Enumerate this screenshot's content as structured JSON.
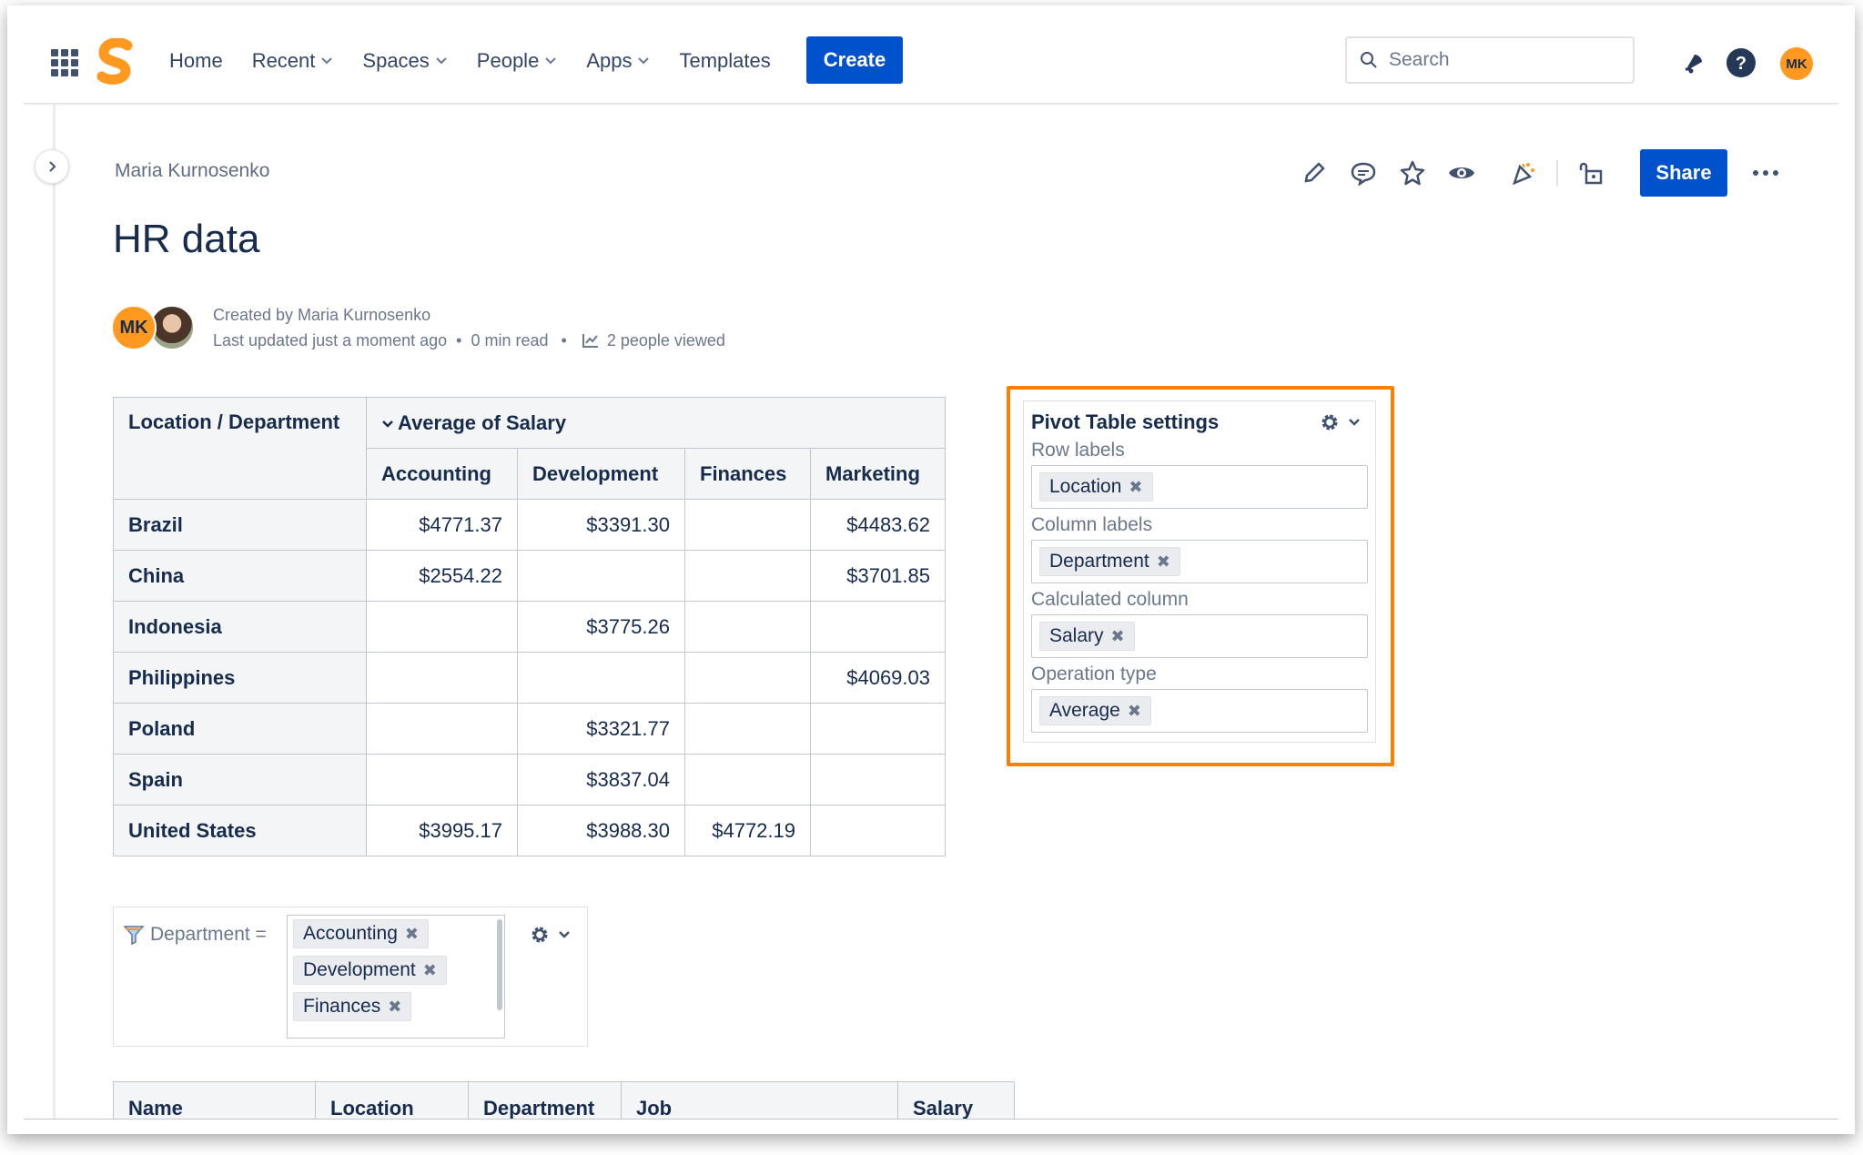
{
  "nav": {
    "items": [
      {
        "label": "Home",
        "dropdown": false
      },
      {
        "label": "Recent",
        "dropdown": true
      },
      {
        "label": "Spaces",
        "dropdown": true
      },
      {
        "label": "People",
        "dropdown": true
      },
      {
        "label": "Apps",
        "dropdown": true
      },
      {
        "label": "Templates",
        "dropdown": false
      }
    ],
    "create_label": "Create",
    "search_placeholder": "Search",
    "user_initials": "MK"
  },
  "page": {
    "breadcrumb": "Maria Kurnosenko",
    "title": "HR data",
    "share_label": "Share",
    "author_initials": "MK",
    "created_by": "Created by Maria Kurnosenko",
    "last_updated": "Last updated just a moment ago",
    "read_time": "0 min read",
    "viewed": "2 people viewed"
  },
  "pivot": {
    "corner_label": "Location / Department",
    "measure_label": "Average of Salary",
    "columns": [
      "Accounting",
      "Development",
      "Finances",
      "Marketing"
    ],
    "rows": [
      {
        "label": "Brazil",
        "values": [
          "$4771.37",
          "$3391.30",
          "",
          "$4483.62"
        ]
      },
      {
        "label": "China",
        "values": [
          "$2554.22",
          "",
          "",
          "$3701.85"
        ]
      },
      {
        "label": "Indonesia",
        "values": [
          "",
          "$3775.26",
          "",
          ""
        ]
      },
      {
        "label": "Philippines",
        "values": [
          "",
          "",
          "",
          "$4069.03"
        ]
      },
      {
        "label": "Poland",
        "values": [
          "",
          "$3321.77",
          "",
          ""
        ]
      },
      {
        "label": "Spain",
        "values": [
          "",
          "$3837.04",
          "",
          ""
        ]
      },
      {
        "label": "United States",
        "values": [
          "$3995.17",
          "$3988.30",
          "$4772.19",
          ""
        ]
      }
    ]
  },
  "settings": {
    "title": "Pivot Table settings",
    "row_labels_label": "Row labels",
    "row_labels_value": "Location",
    "column_labels_label": "Column labels",
    "column_labels_value": "Department",
    "calculated_label": "Calculated column",
    "calculated_value": "Salary",
    "operation_label": "Operation type",
    "operation_value": "Average",
    "highlight_color": "#ff7f00"
  },
  "filter": {
    "label": "Department =",
    "values": [
      "Accounting",
      "Development",
      "Finances"
    ]
  },
  "data_table": {
    "headers": [
      "Name",
      "Location",
      "Department",
      "Job",
      "Salary"
    ]
  },
  "colors": {
    "brand_blue": "#0052cc",
    "avatar_orange": "#ff991f",
    "logo_orange": "#ff991f"
  }
}
